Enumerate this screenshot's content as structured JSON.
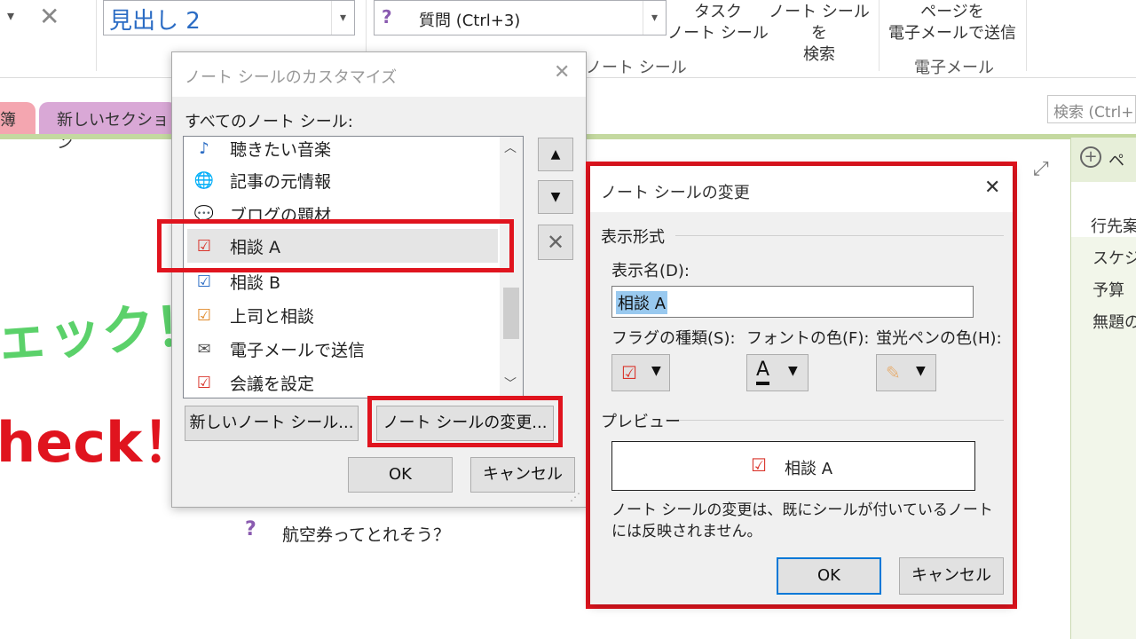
{
  "ribbon": {
    "style_box_value": "見出し 2",
    "tag_box_value": "質問 (Ctrl+3)",
    "task_btn": "タスク\nノート シール",
    "find_btn": "ノート シールを\n検索",
    "email_btn": "ページを\n電子メールで送信",
    "group_tags": "ノート シール",
    "group_email": "電子メール"
  },
  "tabs": {
    "tab1": "簿",
    "tab2": "新しいセクション",
    "search_placeholder": "検索 (Ctrl+"
  },
  "right_panel": {
    "add_page": "ペ",
    "items": [
      "行先案",
      "スケジ",
      "予算",
      "無題の"
    ]
  },
  "canvas": {
    "handwriting_1": "ェック！",
    "handwriting_2": "heck！！",
    "question_text": "航空券ってとれそう？"
  },
  "customize_dialog": {
    "title": "ノート シールのカスタマイズ",
    "list_label": "すべてのノート シール:",
    "items": [
      {
        "label": "聴きたい音楽"
      },
      {
        "label": "記事の元情報"
      },
      {
        "label": "ブログの題材"
      },
      {
        "label": "相談 A"
      },
      {
        "label": "相談 B"
      },
      {
        "label": "上司と相談"
      },
      {
        "label": "電子メールで送信"
      },
      {
        "label": "会議を設定"
      }
    ],
    "new_tag_btn": "新しいノート シール...",
    "modify_tag_btn": "ノート シールの変更...",
    "ok": "OK",
    "cancel": "キャンセル"
  },
  "modify_dialog": {
    "title": "ノート シールの変更",
    "section_format": "表示形式",
    "display_name_label": "表示名(D):",
    "display_name_value": "相談 A",
    "flag_type_label": "フラグの種類(S):",
    "font_color_label": "フォントの色(F):",
    "highlight_label": "蛍光ペンの色(H):",
    "preview_label": "プレビュー",
    "preview_text": "相談 A",
    "note": "ノート シールの変更は、既にシールが付いているノートには反映されません。",
    "ok": "OK",
    "cancel": "キャンセル"
  },
  "colors": {
    "highlight_red": "#e0141e",
    "handwriting_green": "#5bd16a",
    "handwriting_red": "#e0141e",
    "section_tab_pink": "#f4a6b0",
    "section_tab_purple": "#d9a8d6",
    "accent_blue": "#2b6cc4"
  }
}
